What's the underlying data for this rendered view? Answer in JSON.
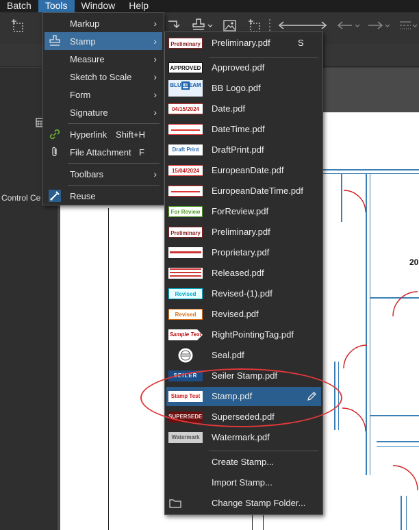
{
  "menubar": {
    "items": [
      {
        "label": "Batch",
        "active": false
      },
      {
        "label": "Tools",
        "active": true
      },
      {
        "label": "Window",
        "active": false
      },
      {
        "label": "Help",
        "active": false
      }
    ]
  },
  "left_pane": {
    "label": "Control Ce"
  },
  "tools_menu": {
    "items": [
      {
        "label": "Markup",
        "submenu": true
      },
      {
        "label": "Stamp",
        "submenu": true,
        "highlighted": true,
        "icon": "stamp-icon"
      },
      {
        "label": "Measure",
        "submenu": true
      },
      {
        "label": "Sketch to Scale",
        "submenu": true
      },
      {
        "label": "Form",
        "submenu": true
      },
      {
        "label": "Signature",
        "submenu": true
      },
      {
        "label": "Hyperlink",
        "shortcut": "Shift+H",
        "icon": "hyperlink-icon"
      },
      {
        "label": "File Attachment",
        "shortcut": "F",
        "icon": "paperclip-icon"
      },
      {
        "label": "Toolbars",
        "submenu": true
      },
      {
        "label": "Reuse",
        "icon": "reuse-brush-icon"
      }
    ]
  },
  "stamp_menu": {
    "top_item": {
      "label": "Preliminary.pdf",
      "shortcut": "S",
      "thumb_text": "Preliminary"
    },
    "stamps": [
      {
        "label": "Approved.pdf",
        "thumb_text": "APPROVED"
      },
      {
        "label": "BB Logo.pdf",
        "thumb_text": "BLUEBEAM"
      },
      {
        "label": "Date.pdf",
        "thumb_text": "04/15/2024"
      },
      {
        "label": "DateTime.pdf",
        "thumb_text": ""
      },
      {
        "label": "DraftPrint.pdf",
        "thumb_text": "Draft Print"
      },
      {
        "label": "EuropeanDate.pdf",
        "thumb_text": "15/04/2024"
      },
      {
        "label": "EuropeanDateTime.pdf",
        "thumb_text": ""
      },
      {
        "label": "ForReview.pdf",
        "thumb_text": "For Review"
      },
      {
        "label": "Preliminary.pdf",
        "thumb_text": "Preliminary"
      },
      {
        "label": "Proprietary.pdf",
        "thumb_text": ""
      },
      {
        "label": "Released.pdf",
        "thumb_text": ""
      },
      {
        "label": "Revised-(1).pdf",
        "thumb_text": "Revised"
      },
      {
        "label": "Revised.pdf",
        "thumb_text": "Revised"
      },
      {
        "label": "RightPointingTag.pdf",
        "thumb_text": "Sample Text"
      },
      {
        "label": "Seal.pdf",
        "thumb_text": ""
      },
      {
        "label": "Seiler Stamp.pdf",
        "thumb_text": "SEILER"
      },
      {
        "label": "Stamp.pdf",
        "thumb_text": "Stamp Test",
        "highlighted": true
      },
      {
        "label": "Superseded.pdf",
        "thumb_text": "SUPERSEDED"
      },
      {
        "label": "Watermark.pdf",
        "thumb_text": "Watermark"
      }
    ],
    "actions": [
      {
        "label": "Create Stamp..."
      },
      {
        "label": "Import Stamp..."
      },
      {
        "label": "Change Stamp Folder...",
        "icon": "folder-icon"
      }
    ]
  },
  "document": {
    "partial_label": "20"
  },
  "colors": {
    "menu_highlight": "#3a6d9c",
    "annotation_ellipse": "#e0383a",
    "drawing_lines": "#3a7fb5"
  }
}
